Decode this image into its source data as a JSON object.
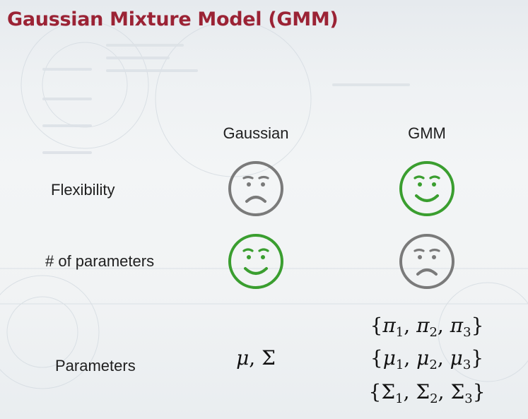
{
  "slide": {
    "title": "Gaussian Mixture Model (GMM)"
  },
  "columns": {
    "gaussian": "Gaussian",
    "gmm": "GMM"
  },
  "rows": {
    "flexibility": "Flexibility",
    "num_parameters": "# of parameters",
    "parameters": "Parameters"
  },
  "ratings": {
    "flexibility": {
      "gaussian": "sad",
      "gmm": "happy"
    },
    "num_parameters": {
      "gaussian": "happy",
      "gmm": "sad"
    }
  },
  "params": {
    "gaussian": {
      "mean": "μ",
      "cov": "Σ"
    },
    "gmm": {
      "weights": {
        "symbol": "π",
        "indices": [
          "1",
          "2",
          "3"
        ]
      },
      "means": {
        "symbol": "μ",
        "indices": [
          "1",
          "2",
          "3"
        ]
      },
      "covs": {
        "symbol": "Σ",
        "indices": [
          "1",
          "2",
          "3"
        ]
      }
    }
  },
  "colors": {
    "title": "#9b2335",
    "happy": "#3a9e2f",
    "sad": "#7a7a7a"
  }
}
